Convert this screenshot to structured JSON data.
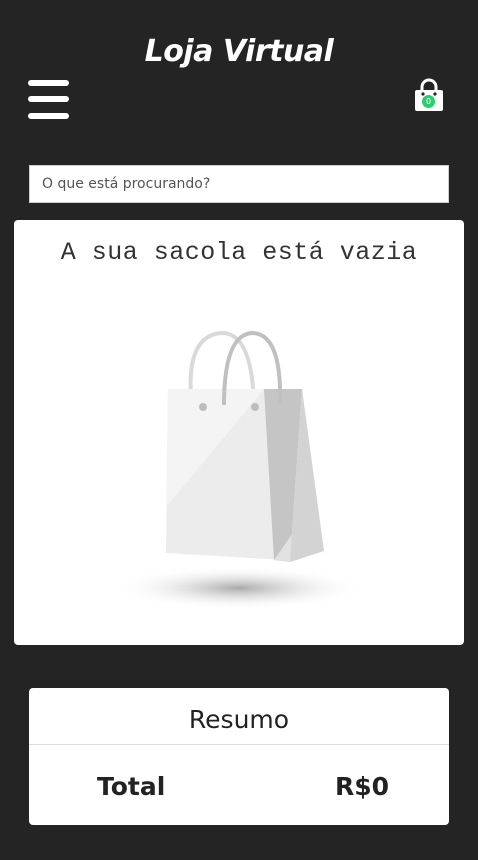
{
  "header": {
    "title": "Loja Virtual",
    "menu_icon": "hamburger-menu-icon",
    "cart_icon": "shopping-bag-icon",
    "cart_count": "0"
  },
  "search": {
    "placeholder": "O que está procurando?",
    "value": ""
  },
  "bag": {
    "empty_message": "A sua sacola está vazia",
    "illustration": "empty-shopping-bag"
  },
  "summary": {
    "title": "Resumo",
    "total_label": "Total",
    "total_value": "R$0"
  },
  "colors": {
    "background": "#242424",
    "card": "#ffffff",
    "badge": "#2ecc71"
  }
}
